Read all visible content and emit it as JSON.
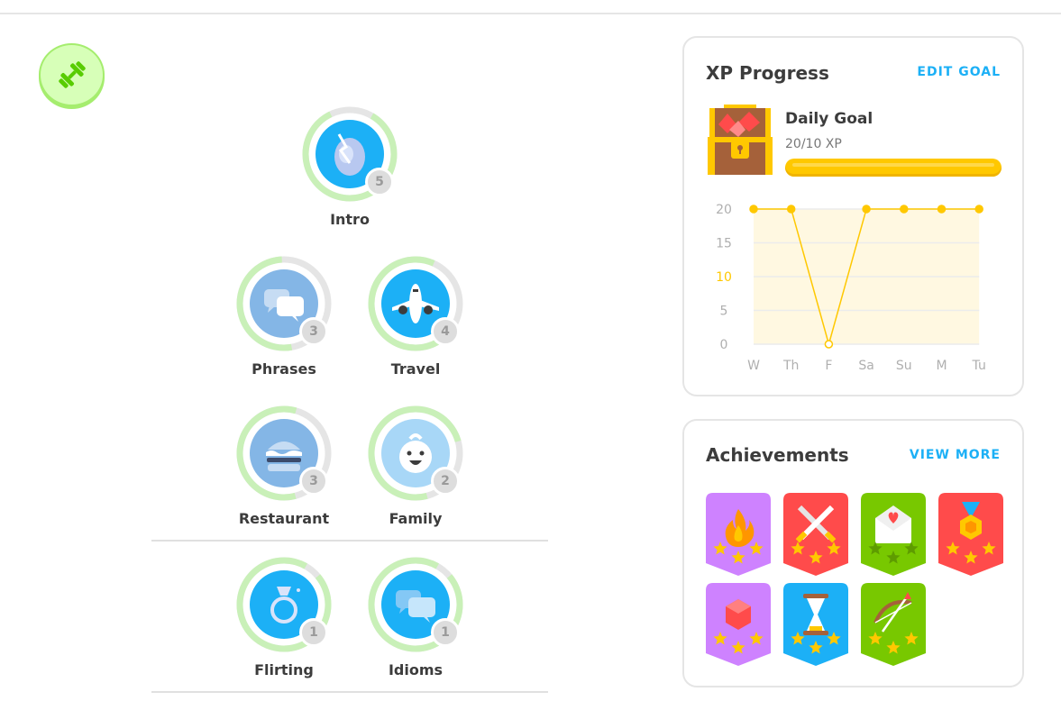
{
  "skills": [
    {
      "name": "Intro",
      "level": "5",
      "color": "#1cb0f6",
      "icon": "egg-icon"
    },
    {
      "name": "Phrases",
      "level": "3",
      "color": "#84b6e6",
      "icon": "speech-bubbles-icon"
    },
    {
      "name": "Travel",
      "level": "4",
      "color": "#1cb0f6",
      "icon": "airplane-icon"
    },
    {
      "name": "Restaurant",
      "level": "3",
      "color": "#84b6e6",
      "icon": "burger-icon"
    },
    {
      "name": "Family",
      "level": "2",
      "color": "#a8d7f7",
      "icon": "baby-icon"
    },
    {
      "name": "Flirting",
      "level": "1",
      "color": "#1cb0f6",
      "icon": "ring-icon"
    },
    {
      "name": "Idioms",
      "level": "1",
      "color": "#1cb0f6",
      "icon": "speech-bubbles-icon"
    }
  ],
  "xp_progress": {
    "title": "XP Progress",
    "edit_goal": "EDIT GOAL",
    "daily_goal_title": "Daily Goal",
    "daily_goal_value": "20/10 XP",
    "daily_goal_fraction": 1.0,
    "icon": "treasure-chest-icon"
  },
  "chart_data": {
    "type": "line",
    "categories": [
      "W",
      "Th",
      "F",
      "Sa",
      "Su",
      "M",
      "Tu"
    ],
    "values": [
      20,
      20,
      0,
      20,
      20,
      20,
      20
    ],
    "yticks": [
      20,
      15,
      10,
      5,
      0
    ],
    "goal": 10,
    "ylim": [
      0,
      20
    ],
    "grid": true,
    "line_color": "#ffc800",
    "area_color": "#fff8e1",
    "goal_color": "#ffc800"
  },
  "achievements": {
    "title": "Achievements",
    "view_more": "VIEW MORE",
    "badges": [
      {
        "icon": "fire-icon",
        "color": "#ce82ff",
        "stars": 3
      },
      {
        "icon": "crossed-swords-icon",
        "color": "#ff4b4b",
        "stars": 3
      },
      {
        "icon": "love-letter-icon",
        "color": "#78c800",
        "stars": 0
      },
      {
        "icon": "medal-icon",
        "color": "#ff4b4b",
        "stars": 3
      },
      {
        "icon": "gem-icon",
        "color": "#ce82ff",
        "stars": 3
      },
      {
        "icon": "hourglass-icon",
        "color": "#1cb0f6",
        "stars": 3
      },
      {
        "icon": "bow-arrow-icon",
        "color": "#78c800",
        "stars": 3
      }
    ]
  }
}
